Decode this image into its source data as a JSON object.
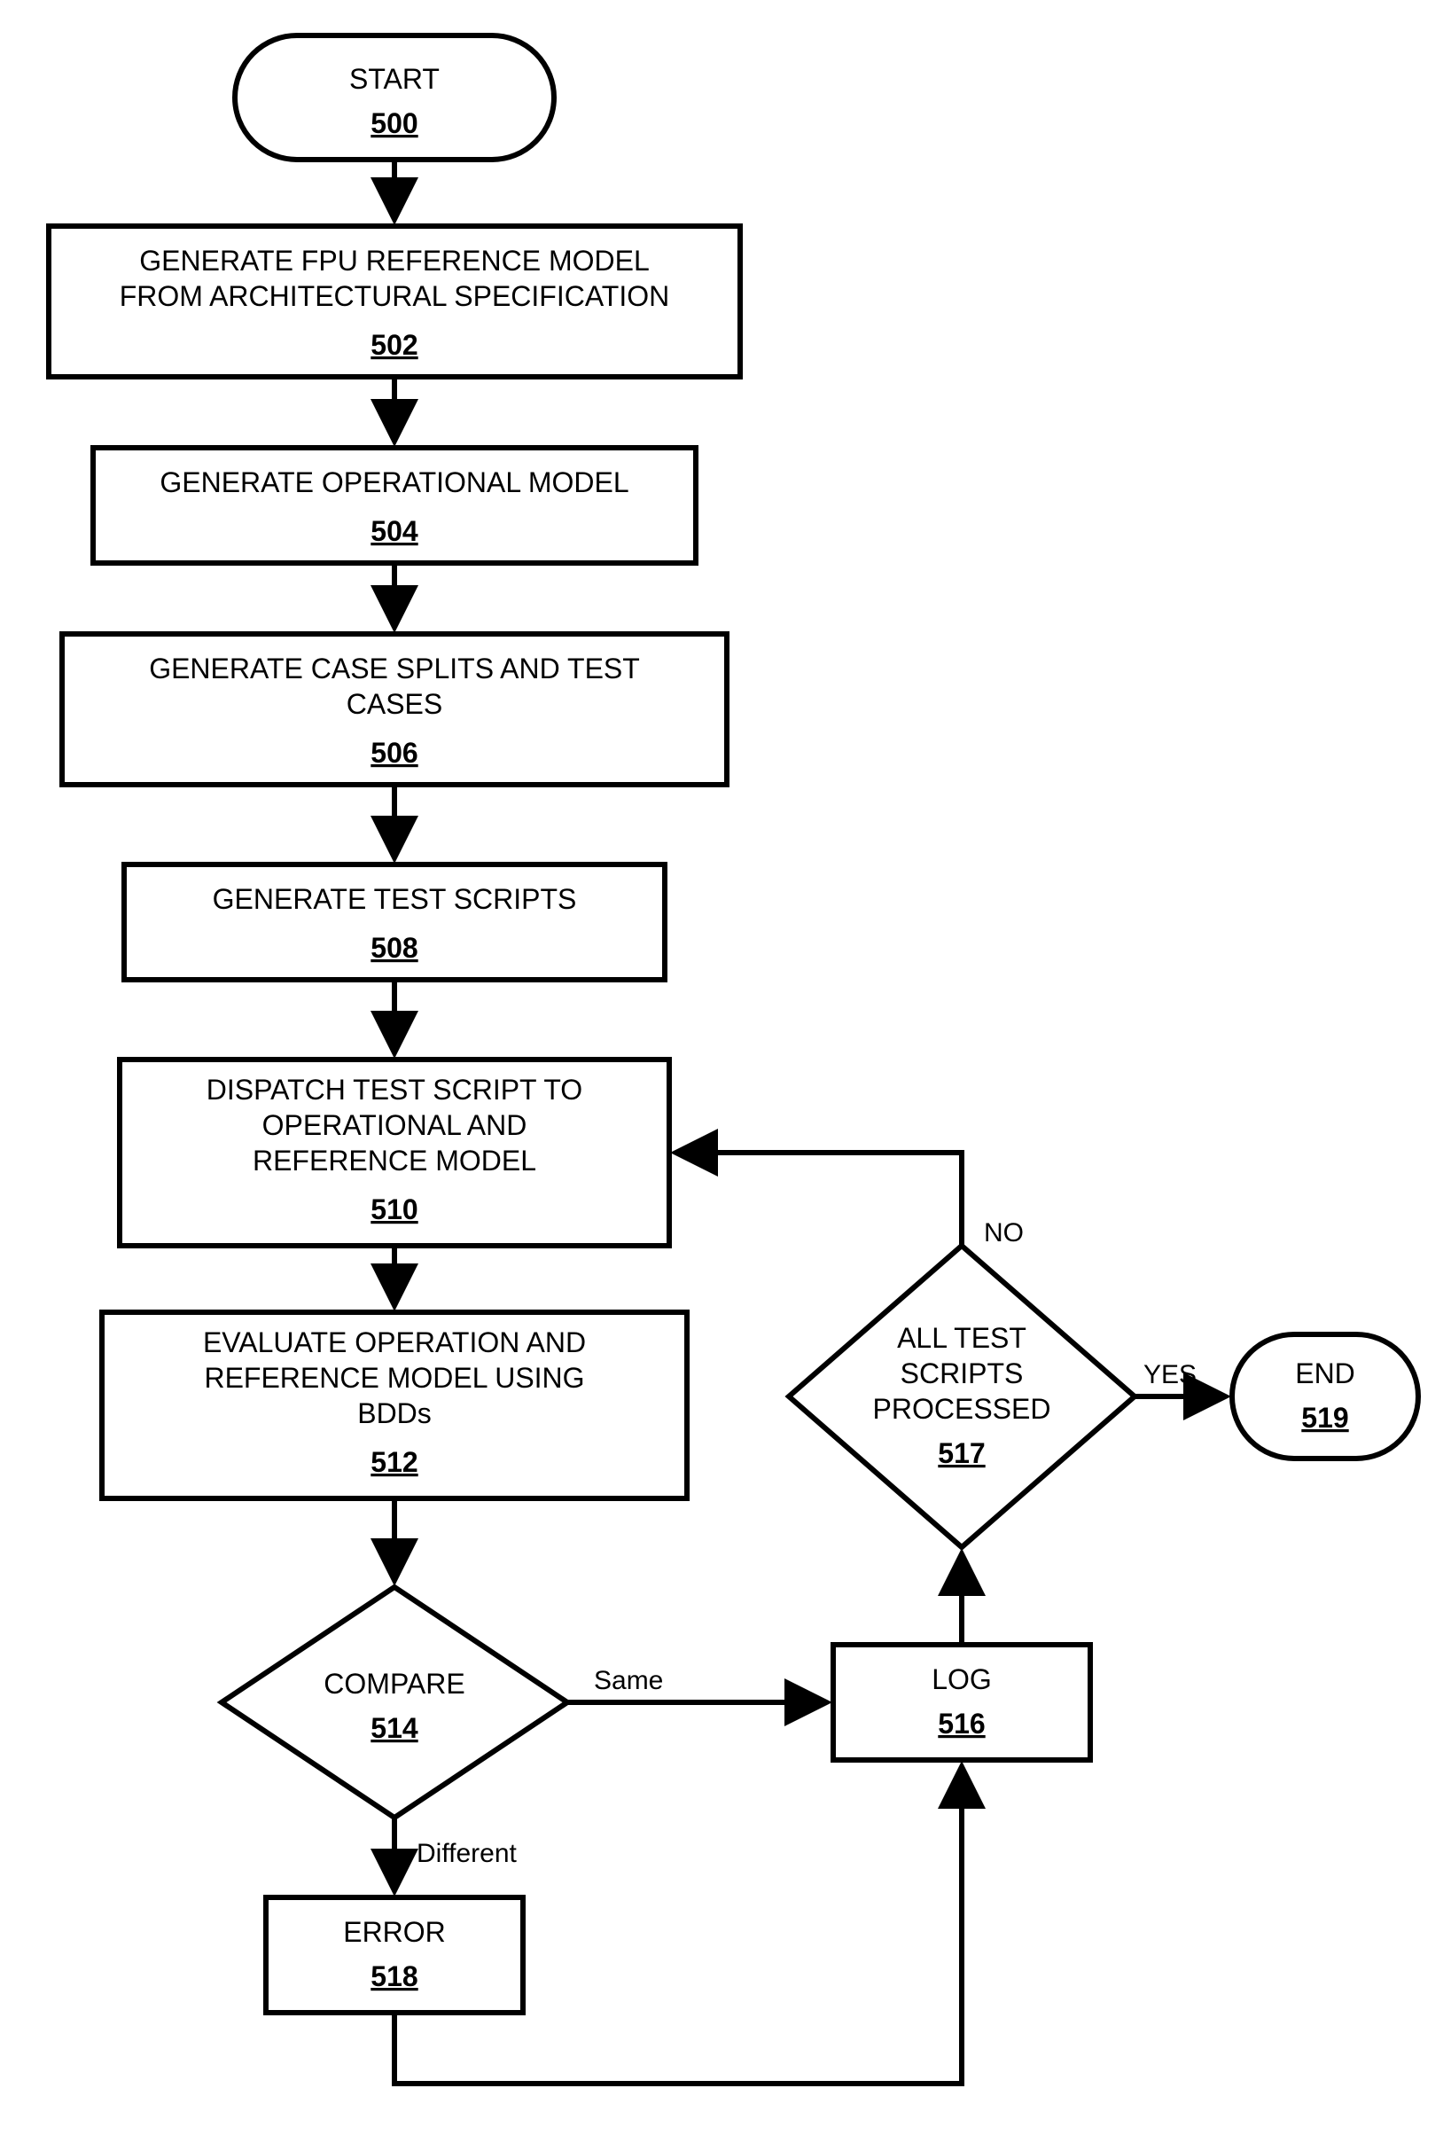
{
  "flowchart": {
    "nodes": {
      "start": {
        "label": "START",
        "ref": "500",
        "type": "terminator"
      },
      "n502": {
        "lines": [
          "GENERATE FPU REFERENCE MODEL",
          "FROM ARCHITECTURAL SPECIFICATION"
        ],
        "ref": "502",
        "type": "process"
      },
      "n504": {
        "lines": [
          "GENERATE OPERATIONAL MODEL"
        ],
        "ref": "504",
        "type": "process"
      },
      "n506": {
        "lines": [
          "GENERATE CASE SPLITS AND TEST",
          "CASES"
        ],
        "ref": "506",
        "type": "process"
      },
      "n508": {
        "lines": [
          "GENERATE TEST SCRIPTS"
        ],
        "ref": "508",
        "type": "process"
      },
      "n510": {
        "lines": [
          "DISPATCH TEST SCRIPT TO",
          "OPERATIONAL AND",
          "REFERENCE MODEL"
        ],
        "ref": "510",
        "type": "process"
      },
      "n512": {
        "lines": [
          "EVALUATE OPERATION AND",
          "REFERENCE MODEL USING",
          "BDDs"
        ],
        "ref": "512",
        "type": "process"
      },
      "n514": {
        "label": "COMPARE",
        "ref": "514",
        "type": "decision"
      },
      "n516": {
        "label": "LOG",
        "ref": "516",
        "type": "process"
      },
      "n517": {
        "lines": [
          "ALL TEST",
          "SCRIPTS",
          "PROCESSED"
        ],
        "ref": "517",
        "type": "decision"
      },
      "n518": {
        "label": "ERROR",
        "ref": "518",
        "type": "process"
      },
      "end": {
        "label": "END",
        "ref": "519",
        "type": "terminator"
      }
    },
    "edge_labels": {
      "compare_same": "Same",
      "compare_diff": "Different",
      "all_no": "NO",
      "all_yes": "YES"
    }
  }
}
